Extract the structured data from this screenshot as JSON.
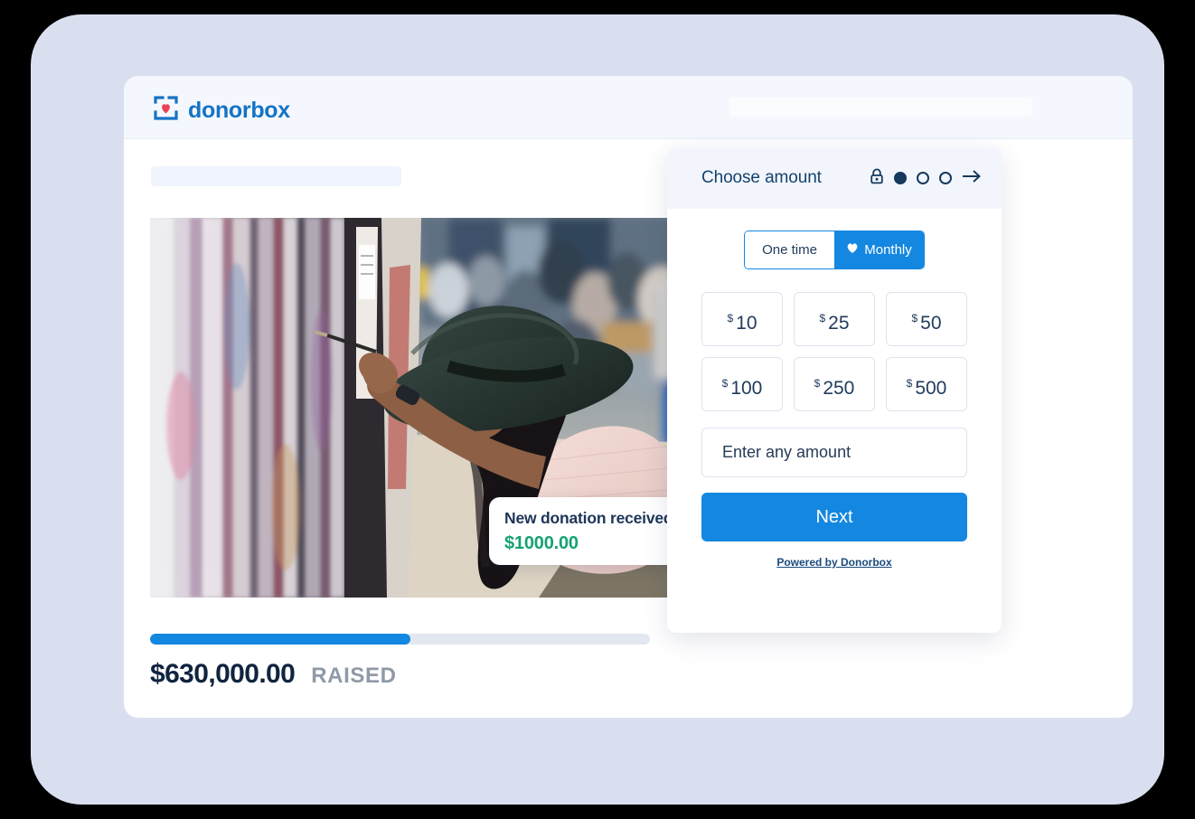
{
  "browser": {
    "brand_name": "donorbox",
    "brand_logo_icon": "donorbox-heart-logo",
    "header_placeholder": "",
    "title_placeholder": ""
  },
  "hero": {
    "photo_alt": "Woman in dark green wide-brim hat painting a graffiti wall with blurred crowd behind",
    "toast": {
      "title": "New donation received",
      "amount": "$1000.00",
      "amount_color": "#16a271"
    }
  },
  "progress": {
    "percent": 52,
    "raised_amount": "$630,000.00",
    "raised_label": "RAISED",
    "fill_color": "#1487e0",
    "track_color": "#e3e7ef"
  },
  "form": {
    "header": {
      "title": "Choose amount",
      "lock_icon": "lock-icon",
      "arrow_icon": "arrow-right-icon",
      "steps": [
        {
          "label": "1",
          "active": true
        },
        {
          "label": "2",
          "active": false
        },
        {
          "label": "3",
          "active": false
        }
      ]
    },
    "frequency": {
      "one_time_label": "One time",
      "monthly_label": "Monthly",
      "monthly_icon": "heart-icon",
      "selected": "Monthly"
    },
    "amounts": [
      {
        "currency": "$",
        "value": "10"
      },
      {
        "currency": "$",
        "value": "25"
      },
      {
        "currency": "$",
        "value": "50"
      },
      {
        "currency": "$",
        "value": "100"
      },
      {
        "currency": "$",
        "value": "250"
      },
      {
        "currency": "$",
        "value": "500"
      }
    ],
    "custom_amount": {
      "placeholder": "Enter any amount",
      "value": ""
    },
    "next_label": "Next",
    "powered_by": "Powered by Donorbox",
    "accent_color": "#1487e0"
  }
}
